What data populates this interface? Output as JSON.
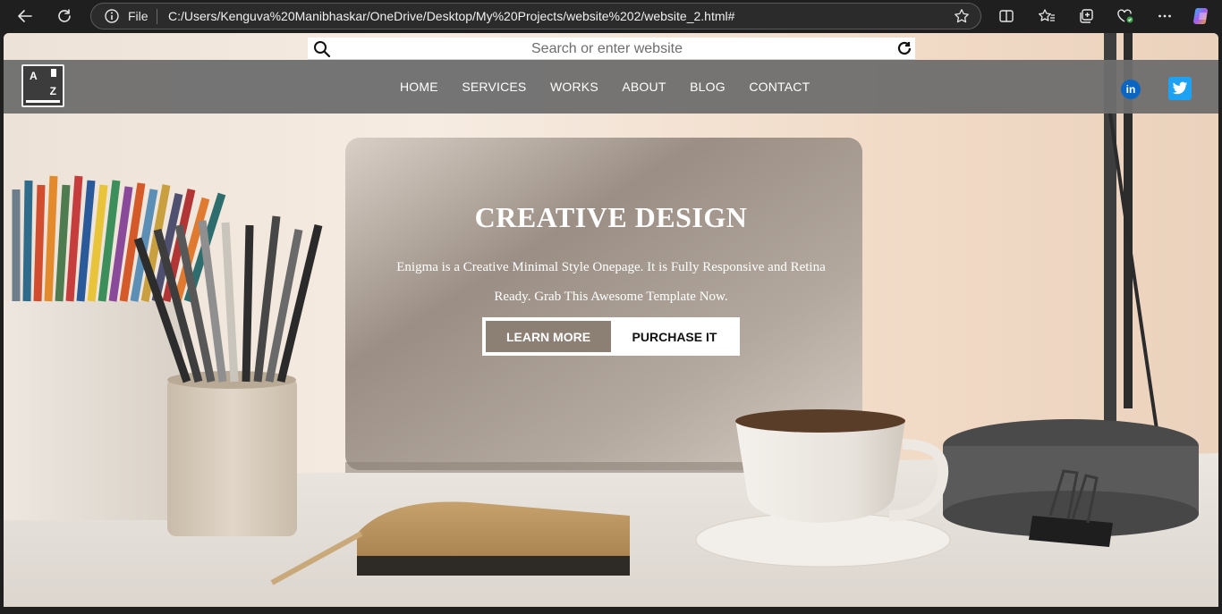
{
  "browser": {
    "protocol_label": "File",
    "url": "C:/Users/Kenguva%20Manibhaskar/OneDrive/Desktop/My%20Projects/website%202/website_2.html#"
  },
  "search": {
    "placeholder": "Search or enter website"
  },
  "nav": {
    "logo": {
      "top_letter": "A",
      "bottom_letter": "Z"
    },
    "items": [
      {
        "label": "HOME"
      },
      {
        "label": "SERVICES"
      },
      {
        "label": "WORKS"
      },
      {
        "label": "ABOUT"
      },
      {
        "label": "BLOG"
      },
      {
        "label": "CONTACT"
      }
    ],
    "social": {
      "linkedin_label": "in"
    }
  },
  "hero": {
    "title": "CREATIVE DESIGN",
    "subtitle": "Enigma is a Creative Minimal Style Onepage. It is Fully Responsive and Retina Ready. Grab This Awesome Template Now.",
    "learn_more": "LEARN MORE",
    "purchase": "PURCHASE IT"
  },
  "colors": {
    "chrome_bg": "#1f1f1f",
    "nav_bg": "#6e6e6e",
    "learn_button_bg": "#8c7f74",
    "linkedin": "#0a66c2",
    "twitter": "#1da1f2"
  },
  "icons": [
    "back-arrow-icon",
    "refresh-icon",
    "info-icon",
    "favorite-star-icon",
    "split-screen-icon",
    "favorites-icon",
    "collections-icon",
    "performance-icon",
    "more-icon",
    "copilot-icon",
    "search-icon",
    "reload-icon",
    "linkedin-icon",
    "twitter-icon"
  ]
}
